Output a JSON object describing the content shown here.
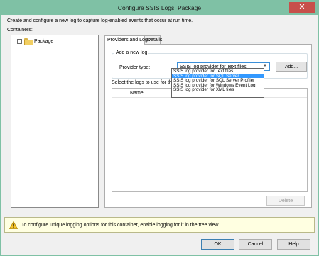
{
  "window": {
    "title": "Configure SSIS Logs: Package",
    "close_glyph": "✕"
  },
  "intro_text": "Create and configure a new log to capture log-enabled events that occur at run time.",
  "containers": {
    "label": "Containers:",
    "items": [
      {
        "label": "Package",
        "checked": false
      }
    ]
  },
  "tabs": [
    {
      "label": "Providers and Logs",
      "active": true
    },
    {
      "label": "Details",
      "active": false
    }
  ],
  "add_log": {
    "group_title": "Add a new log",
    "provider_label": "Provider type:",
    "provider_value": "SSIS log provider for Text files",
    "add_button": "Add..."
  },
  "dropdown": {
    "options": [
      "SSIS log provider for Text files",
      "SSIS log provider for SQL Server",
      "SSIS log provider for SQL Server Profiler",
      "SSIS log provider for Windows Event Log",
      "SSIS log provider for XML files"
    ],
    "selected_index": 1
  },
  "logs": {
    "label": "Select the logs to use for the co",
    "columns": [
      "Name"
    ],
    "delete_button": "Delete"
  },
  "info_message": "To configure unique logging options for this container, enable logging for it in the tree view.",
  "footer": {
    "ok": "OK",
    "cancel": "Cancel",
    "help": "Help"
  },
  "colors": {
    "title_bar": "#7fc1a5",
    "close": "#c7504b",
    "selection": "#3399ff",
    "info_bg": "#ffffe1"
  }
}
